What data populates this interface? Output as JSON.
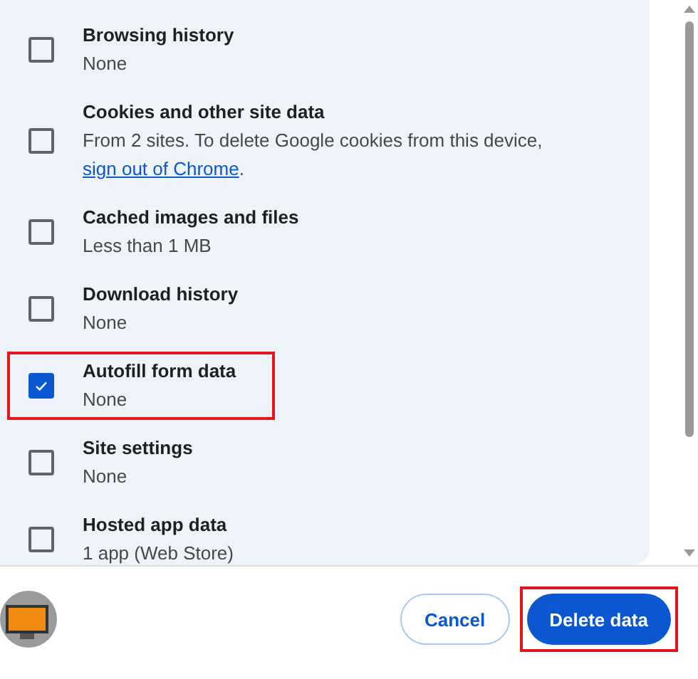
{
  "items": [
    {
      "title": "Browsing history",
      "description": "None",
      "checked": false,
      "highlighted": false
    },
    {
      "title": "Cookies and other site data",
      "description": "From 2 sites. To delete Google cookies from this device, ",
      "link": "sign out of Chrome",
      "after": ".",
      "checked": false,
      "highlighted": false
    },
    {
      "title": "Cached images and files",
      "description": "Less than 1 MB",
      "checked": false,
      "highlighted": false
    },
    {
      "title": "Download history",
      "description": "None",
      "checked": false,
      "highlighted": false
    },
    {
      "title": "Autofill form data",
      "description": "None",
      "checked": true,
      "highlighted": true
    },
    {
      "title": "Site settings",
      "description": "None",
      "checked": false,
      "highlighted": false
    },
    {
      "title": "Hosted app data",
      "description": "1 app (Web Store)",
      "checked": false,
      "highlighted": false
    }
  ],
  "buttons": [
    {
      "label": "Cancel",
      "kind": "secondary",
      "highlighted": false
    },
    {
      "label": "Delete data",
      "kind": "primary",
      "highlighted": true
    }
  ]
}
